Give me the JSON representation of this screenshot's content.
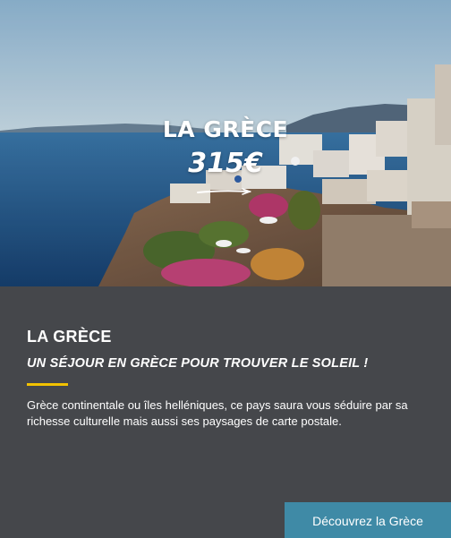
{
  "hero": {
    "title": "LA GRÈCE",
    "price": "315€"
  },
  "panel": {
    "title": "LA GRÈCE",
    "subtitle": "UN SÉJOUR EN GRÈCE POUR TROUVER LE SOLEIL !",
    "description": "Grèce continentale ou îles helléniques, ce pays saura vous séduire par sa richesse culturelle mais aussi ses paysages de carte postale.",
    "cta_label": "Découvrez la Grèce"
  },
  "colors": {
    "panel_background": "#45474b",
    "accent": "#f2c200",
    "button": "#3f8aa6",
    "sea": "#1f5a8e",
    "sky": "#b9d3e3"
  }
}
